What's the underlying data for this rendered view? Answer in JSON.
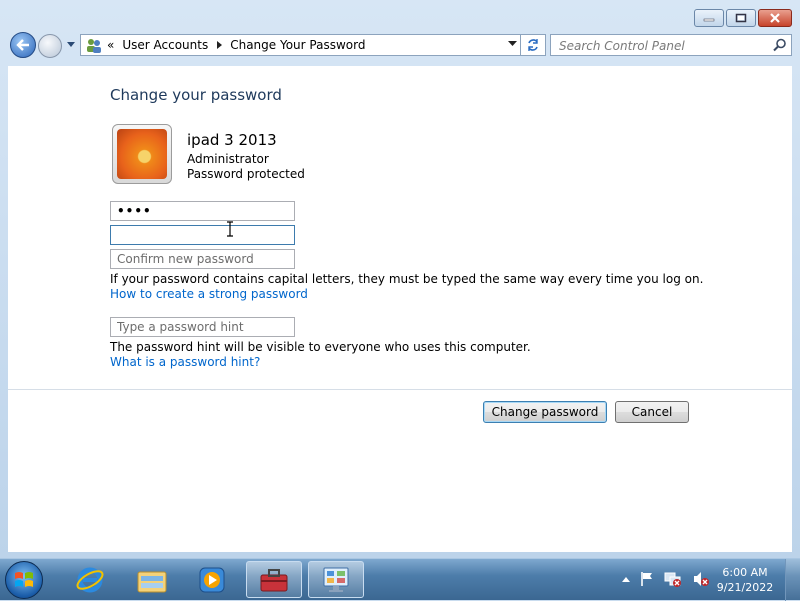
{
  "window": {
    "minimize_icon": "minimize-icon",
    "maximize_icon": "maximize-icon",
    "close_icon": "close-icon"
  },
  "address_bar": {
    "overflow_chevron": "«",
    "crumbs": [
      "User Accounts",
      "Change Your Password"
    ],
    "search_placeholder": "Search Control Panel"
  },
  "page": {
    "title": "Change your password",
    "user": {
      "name": "ipad 3 2013",
      "role": "Administrator",
      "status": "Password protected"
    },
    "current_password_value": "••••",
    "new_password_value": "",
    "confirm_placeholder": "Confirm new password",
    "caps_info": "If your password contains capital letters, they must be typed the same way every time you log on.",
    "strong_password_link": "How to create a strong password",
    "hint_placeholder": "Type a password hint",
    "hint_info": "The password hint will be visible to everyone who uses this computer.",
    "hint_link": "What is a password hint?",
    "change_button": "Change password",
    "cancel_button": "Cancel"
  },
  "taskbar": {
    "items": [
      "start-orb",
      "internet-explorer-icon",
      "windows-explorer-icon",
      "media-player-icon",
      "toolbox-icon",
      "control-panel-icon"
    ],
    "tray_icons": [
      "show-hidden-icons-chevron",
      "action-center-flag-icon",
      "network-icon",
      "volume-muted-icon"
    ],
    "time": "6:00 AM",
    "date": "9/21/2022"
  },
  "colors": {
    "heading": "#1e395b",
    "link": "#0066cc",
    "taskbar": "#4d7daa"
  }
}
